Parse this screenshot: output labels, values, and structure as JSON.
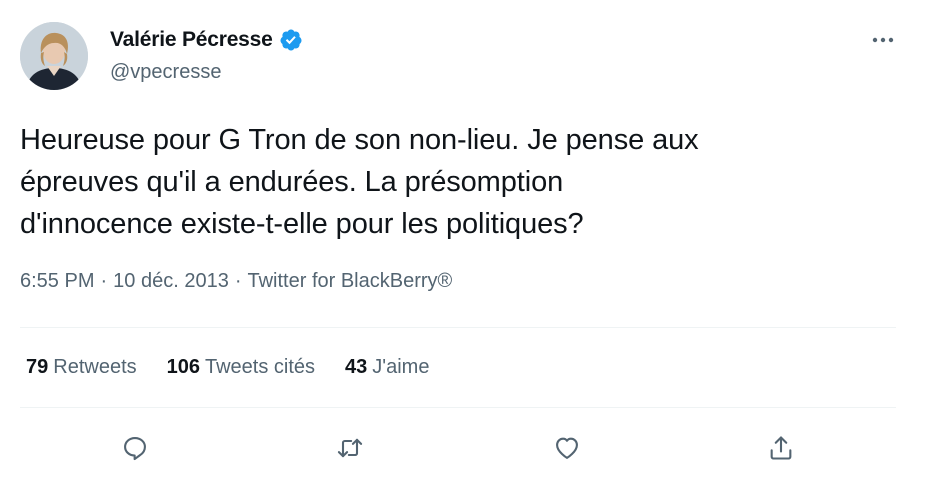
{
  "tweet": {
    "author": {
      "name": "Valérie Pécresse",
      "handle": "@vpecresse",
      "verified": true
    },
    "text": "Heureuse pour G Tron de son non-lieu. Je pense aux\népreuves qu'il a endurées. La présomption\nd'innocence existe-t-elle pour les politiques?",
    "meta": {
      "time": "6:55 PM",
      "separator1": "·",
      "date": "10 déc. 2013",
      "separator2": "·",
      "source": "Twitter for BlackBerry®"
    },
    "stats": {
      "retweets_count": "79",
      "retweets_label": "Retweets",
      "quotes_count": "106",
      "quotes_label": "Tweets cités",
      "likes_count": "43",
      "likes_label": "J'aime"
    },
    "icons": {
      "verified": "verified-badge-icon",
      "more": "more-horizontal-icon",
      "reply": "reply-icon",
      "retweet": "retweet-icon",
      "like": "heart-icon",
      "share": "share-icon"
    },
    "colors": {
      "text_primary": "#0f1419",
      "text_secondary": "#536471",
      "verified_blue": "#1d9bf0",
      "divider": "#eff3f4"
    }
  }
}
